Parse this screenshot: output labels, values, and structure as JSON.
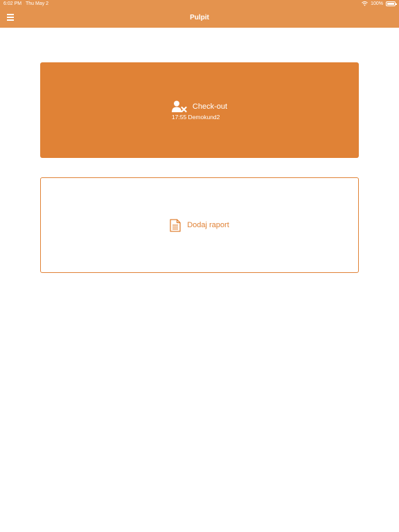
{
  "status_bar": {
    "time": "6:02 PM",
    "date": "Thu May 2",
    "battery": "100%"
  },
  "nav": {
    "title": "Pulpit",
    "menu_icon": "hamburger-menu-icon"
  },
  "colors": {
    "accent": "#e08236",
    "nav_bg": "#e4934e",
    "background": "#ffffff"
  },
  "checkout_card": {
    "label": "Check-out",
    "subtitle": "17:55 Demokund2",
    "icon": "user-x-icon"
  },
  "report_card": {
    "label": "Dodaj raport",
    "icon": "document-icon"
  }
}
